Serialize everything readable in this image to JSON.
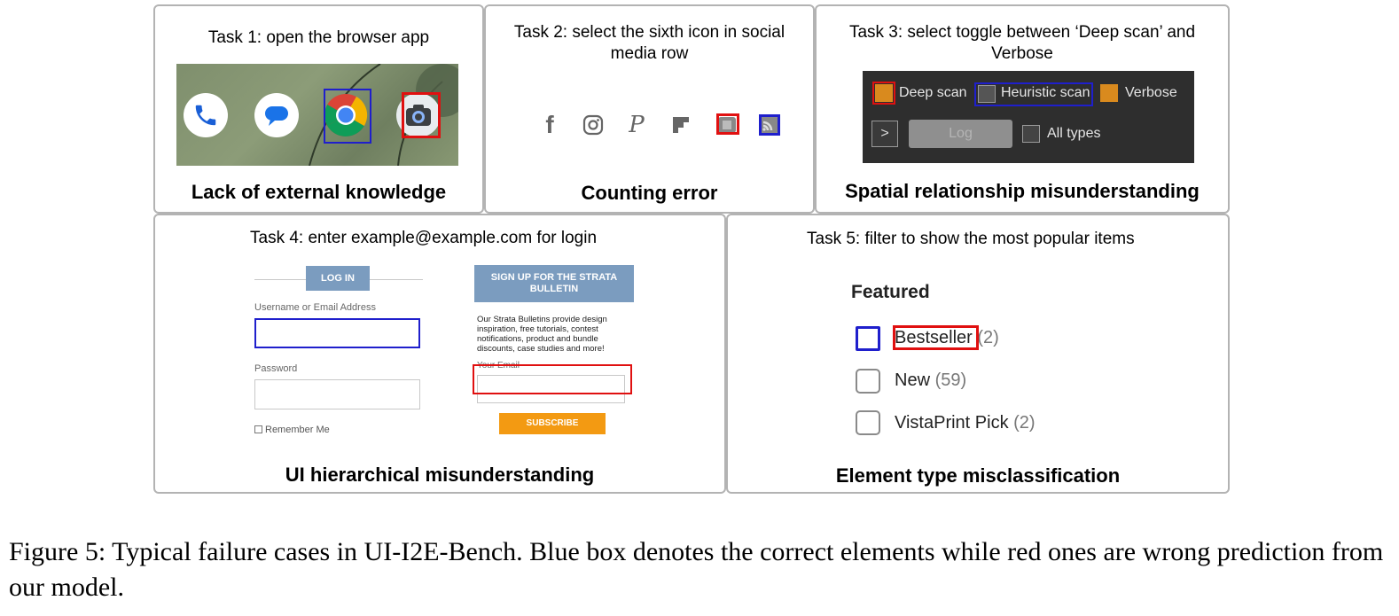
{
  "panels": {
    "p1": {
      "task": "Task 1: open the browser app",
      "caption": "Lack of external knowledge",
      "apps": [
        "phone-app-icon",
        "messages-app-icon",
        "chrome-app-icon",
        "camera-app-icon"
      ]
    },
    "p2": {
      "task": "Task 2: select the sixth icon in social media row",
      "caption": "Counting error",
      "icons": [
        "facebook-icon",
        "instagram-icon",
        "pinterest-icon",
        "flipboard-icon",
        "social-icon-5",
        "rss-icon"
      ],
      "facebook_glyph": "f",
      "pinterest_glyph": "P"
    },
    "p3": {
      "task": "Task 3: select toggle between ‘Deep scan’ and Verbose",
      "caption": "Spatial relationship misunderstanding",
      "deep_scan": "Deep scan",
      "heuristic_scan": "Heuristic scan",
      "verbose": "Verbose",
      "arrow": ">",
      "log": "Log",
      "all_types": "All types",
      "colors": {
        "orange": "#d98a1e",
        "dark_bg": "#2e2e2e"
      }
    },
    "p4": {
      "task": "Task 4: enter example@example.com for login",
      "caption": "UI hierarchical misunderstanding",
      "login_button": "LOG IN",
      "username_label": "Username or Email Address",
      "password_label": "Password",
      "remember_me": "Remember Me",
      "signup_title": "SIGN UP FOR THE STRATA BULLETIN",
      "signup_text": "Our Strata Bulletins provide design inspiration, free tutorials, contest notifications, product and bundle discounts, case studies and more!",
      "email_label": "Your Email",
      "subscribe": "SUBSCRIBE",
      "colors": {
        "steel_blue": "#7b9cbf",
        "orange": "#f39a12"
      }
    },
    "p5": {
      "task": "Task 5: filter to show the most popular items",
      "caption": "Element type misclassification",
      "heading": "Featured",
      "items": [
        {
          "label": "Bestseller",
          "count": "(2)"
        },
        {
          "label": "New",
          "count": "(59)"
        },
        {
          "label": "VistaPrint Pick",
          "count": "(2)"
        }
      ]
    }
  },
  "legend_colors": {
    "correct": "#1f1fcc",
    "wrong": "#e01010"
  },
  "figure_caption": "Figure 5: Typical failure cases in UI-I2E-Bench. Blue box denotes the correct elements while red ones are wrong prediction from our model."
}
